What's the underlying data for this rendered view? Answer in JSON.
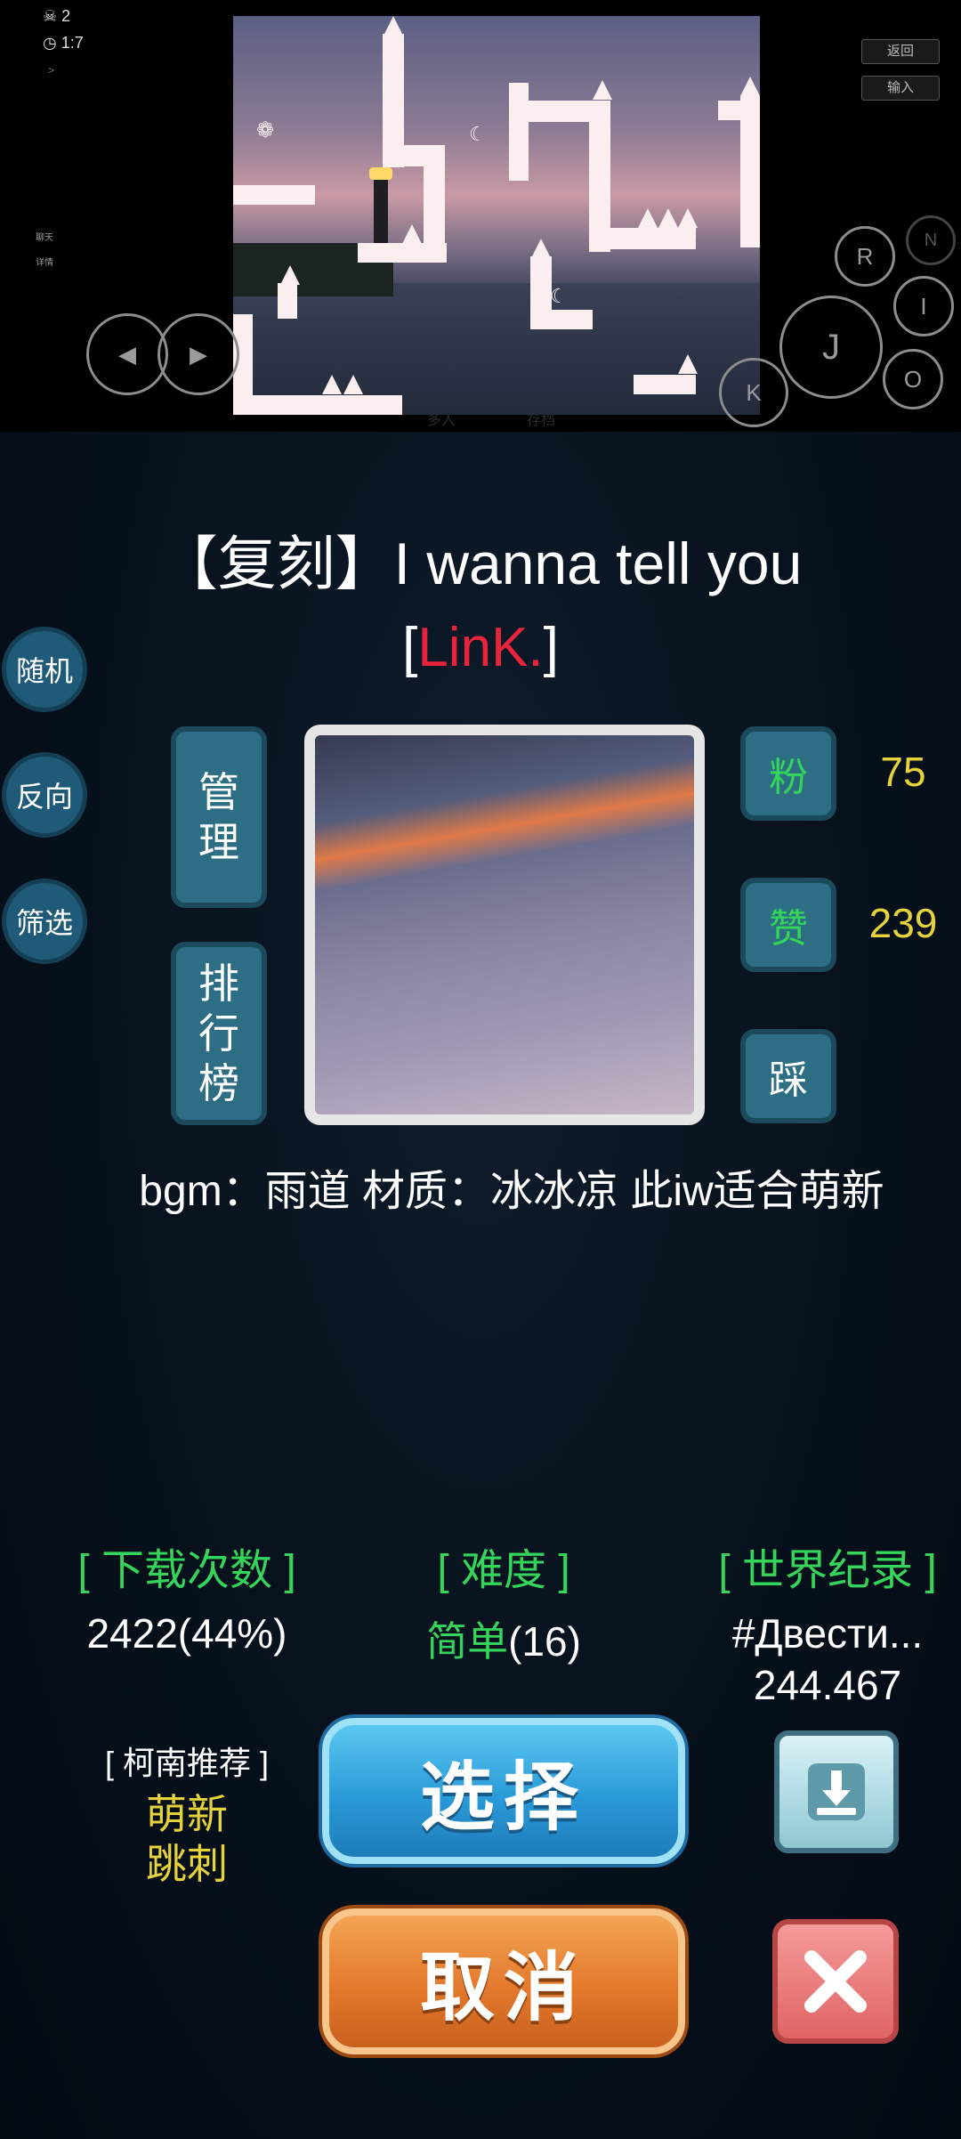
{
  "hud": {
    "deaths": "2",
    "time": "1:7",
    "arrow": ">",
    "chat_label": "聊天",
    "detail_label": "详情",
    "back_label": "返回",
    "input_label": "输入",
    "faint_a": "多人",
    "faint_b": "存档"
  },
  "controls": {
    "r": "R",
    "n": "N",
    "i": "I",
    "j": "J",
    "o": "O",
    "k": "K"
  },
  "level": {
    "title": "【复刻】I wanna tell you",
    "author_open": "[",
    "author": "LinK.",
    "author_close": "]",
    "description": "bgm：雨道 材质：冰冰凉 此iw适合萌新"
  },
  "side_buttons": {
    "random": "随机",
    "reverse": "反向",
    "filter": "筛选"
  },
  "tiles": {
    "manage": "管理",
    "ranking": "排行榜",
    "fans_label": "粉",
    "fans_value": "75",
    "likes_label": "赞",
    "likes_value": "239",
    "dislike_label": "踩"
  },
  "stats": {
    "downloads_header": "[ 下载次数 ]",
    "downloads_value": "2422(44%)",
    "difficulty_header": "[ 难度 ]",
    "difficulty_word": "简单",
    "difficulty_num": "(16)",
    "record_header": "[ 世界纪录 ]",
    "record_holder": "#Двести...",
    "record_time": "244.467"
  },
  "recommend": {
    "header": "[ 柯南推荐 ]",
    "line1": "萌新",
    "line2": "跳刺"
  },
  "actions": {
    "select": "选择",
    "cancel": "取消"
  },
  "colors": {
    "author": "#e8243c",
    "green": "#35d45a",
    "yellow": "#e6d23a"
  }
}
